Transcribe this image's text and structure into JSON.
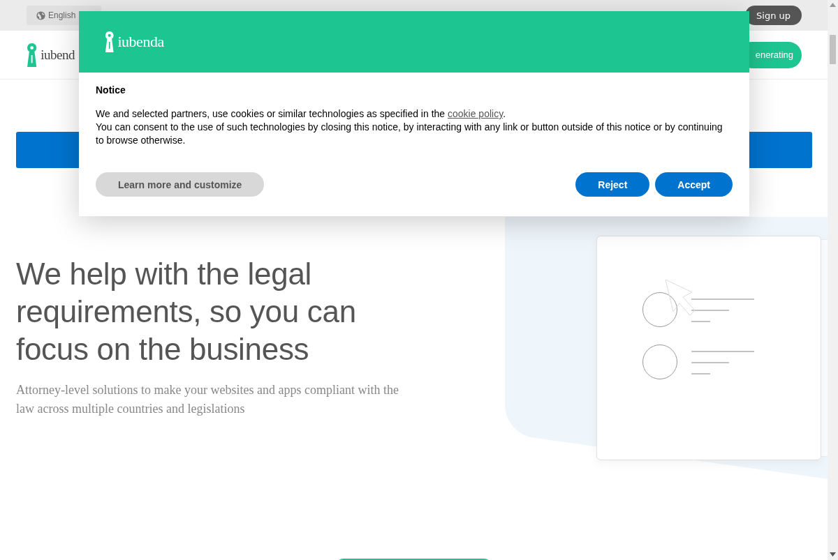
{
  "top_bar": {
    "language": "English",
    "signup": "Sign up"
  },
  "nav": {
    "logo": "iubend",
    "cta": "enerating"
  },
  "hero": {
    "heading": "We help with the legal requirements, so you can focus on the business",
    "subheading": "Attorney-level solutions to make your websites and apps compliant with the law across multiple countries and legislations"
  },
  "notice": {
    "logo": "iubenda",
    "title": "Notice",
    "intro": "We and selected partners, use cookies or similar technologies as specified in the",
    "link": "cookie policy",
    "intro_end": ".",
    "body": "You can consent to the use of such technologies by closing this notice, by interacting with any link or button outside of this notice or by continuing to browse otherwise.",
    "buttons": [
      {
        "label": "Learn more and customize",
        "kind": "secondary"
      },
      {
        "label": "Reject",
        "kind": "primary"
      },
      {
        "label": "Accept",
        "kind": "primary"
      }
    ]
  }
}
